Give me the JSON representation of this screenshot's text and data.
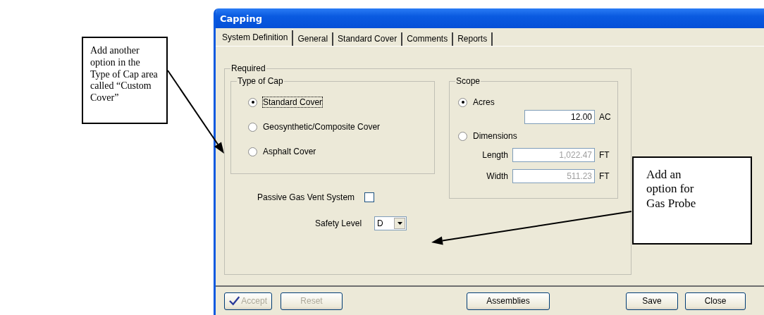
{
  "window": {
    "title": "Capping"
  },
  "tabs": [
    {
      "label": "System Definition",
      "selected": true
    },
    {
      "label": "General",
      "selected": false
    },
    {
      "label": "Standard Cover",
      "selected": false
    },
    {
      "label": "Comments",
      "selected": false
    },
    {
      "label": "Reports",
      "selected": false
    }
  ],
  "required": {
    "title": "Required",
    "type_of_cap": {
      "title": "Type of Cap",
      "options": [
        {
          "label": "Standard Cover",
          "selected": true
        },
        {
          "label": "Geosynthetic/Composite Cover",
          "selected": false
        },
        {
          "label": "Asphalt Cover",
          "selected": false
        }
      ]
    },
    "scope": {
      "title": "Scope",
      "acres": {
        "label": "Acres",
        "selected": true,
        "value": "12.00",
        "unit": "AC"
      },
      "dimensions": {
        "label": "Dimensions",
        "selected": false,
        "fields": [
          {
            "label": "Length",
            "value": "1,022.47",
            "unit": "FT",
            "disabled": true
          },
          {
            "label": "Width",
            "value": "511.23",
            "unit": "FT",
            "disabled": true
          }
        ]
      }
    },
    "passive_gas_vent": {
      "label": "Passive Gas Vent System",
      "checked": false
    },
    "safety_level": {
      "label": "Safety Level",
      "value": "D"
    }
  },
  "buttons": [
    {
      "label": "Accept",
      "disabled": true,
      "kind": "check"
    },
    {
      "label": "Reset",
      "disabled": true,
      "kind": "plain"
    },
    {
      "label": "Assemblies",
      "disabled": false,
      "kind": "plain"
    },
    {
      "label": "Save",
      "disabled": false,
      "kind": "plain"
    },
    {
      "label": "Close",
      "disabled": false,
      "kind": "plain"
    }
  ],
  "callouts": [
    {
      "text": "Add another option in the Type of Cap area called “Custom Cover”"
    },
    {
      "text": "Add an option for Gas Probe"
    }
  ]
}
